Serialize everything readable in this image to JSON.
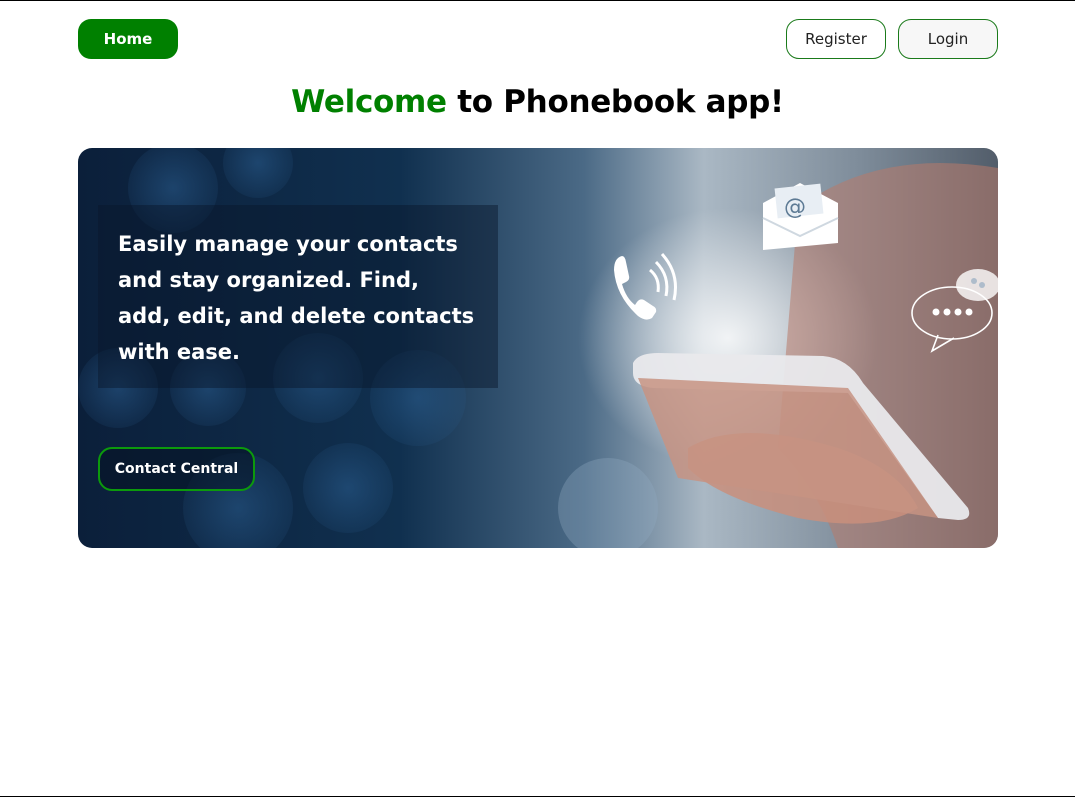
{
  "nav": {
    "home_label": "Home",
    "register_label": "Register",
    "login_label": "Login"
  },
  "heading": {
    "accent": "Welcome",
    "rest": " to Phonebook app!"
  },
  "hero": {
    "description": "Easily manage your contacts and stay organized. Find, add, edit, and delete contacts with ease.",
    "cta_label": "Contact Central",
    "icons": [
      "phone-icon",
      "email-icon",
      "chat-bubble-icon"
    ]
  },
  "colors": {
    "accent": "#008000",
    "hero_dark": "#0b1f3a"
  }
}
